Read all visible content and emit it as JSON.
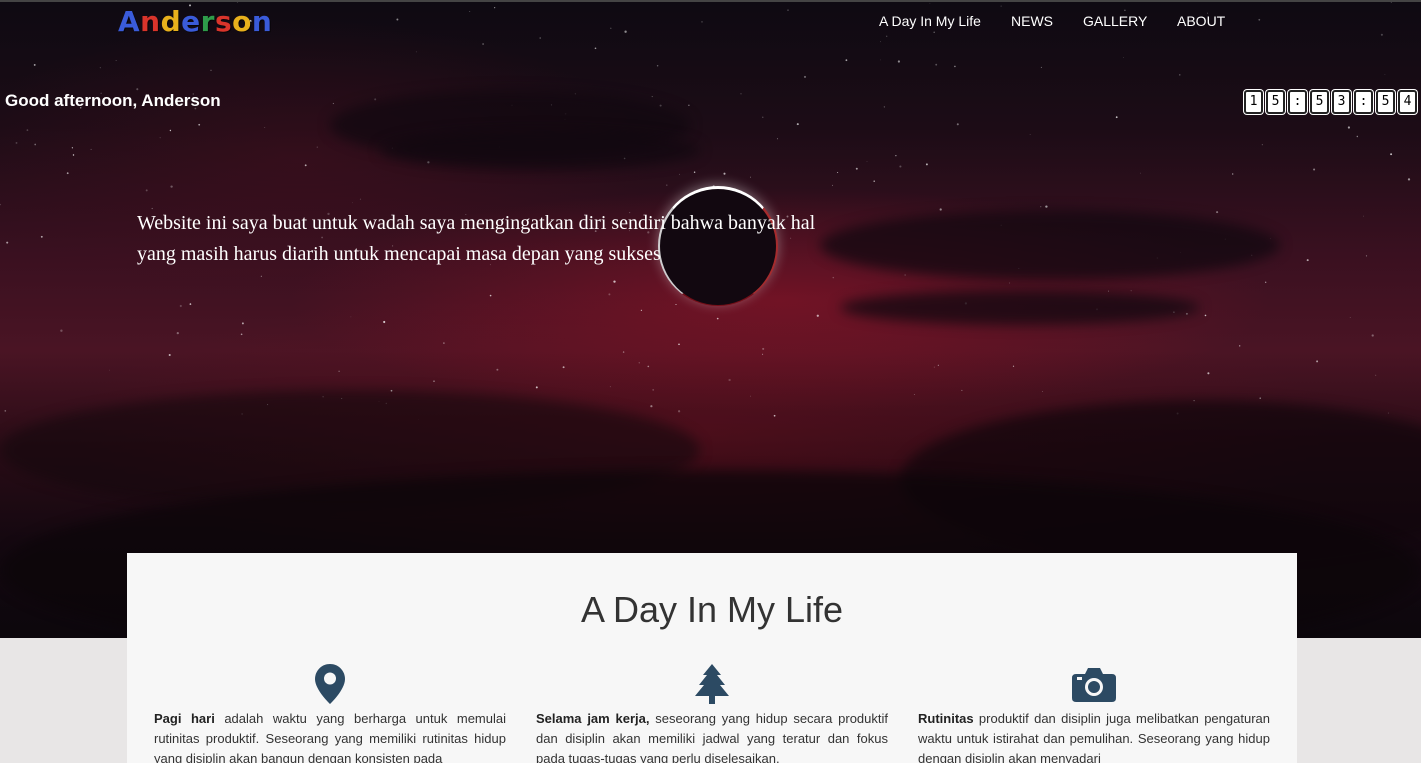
{
  "brand": {
    "logo_letters": [
      {
        "char": "A",
        "color": "#3a5bd9"
      },
      {
        "char": "n",
        "color": "#d9342b"
      },
      {
        "char": "d",
        "color": "#e8b01c"
      },
      {
        "char": "e",
        "color": "#3a5bd9"
      },
      {
        "char": "r",
        "color": "#2e9c4a"
      },
      {
        "char": "s",
        "color": "#d9342b"
      },
      {
        "char": "o",
        "color": "#e8b01c"
      },
      {
        "char": "n",
        "color": "#3a5bd9"
      }
    ]
  },
  "nav": {
    "items": [
      "A Day In My Life",
      "NEWS",
      "GALLERY",
      "ABOUT"
    ]
  },
  "hero": {
    "greeting": "Good afternoon, Anderson",
    "clock": [
      "1",
      "5",
      ":",
      "5",
      "3",
      ":",
      "5",
      "4"
    ],
    "tagline": "Website ini saya buat untuk wadah saya mengingatkan diri sendiri bahwa banyak hal yang masih harus diarih untuk mencapai masa depan yang sukses"
  },
  "section": {
    "title": "A Day In My Life",
    "columns": [
      {
        "icon": "map-pin-icon",
        "bold": "Pagi hari",
        "text": " adalah waktu yang berharga untuk memulai rutinitas produktif. Seseorang yang memiliki rutinitas hidup yang disiplin akan bangun dengan konsisten pada"
      },
      {
        "icon": "tree-icon",
        "bold": "Selama jam kerja,",
        "text": " seseorang yang hidup secara produktif dan disiplin akan memiliki jadwal yang teratur dan fokus pada tugas-tugas yang perlu diselesaikan."
      },
      {
        "icon": "camera-icon",
        "bold": "Rutinitas",
        "text": " produktif dan disiplin juga melibatkan pengaturan waktu untuk istirahat dan pemulihan. Seseorang yang hidup dengan disiplin akan menyadari"
      }
    ]
  },
  "colors": {
    "icon": "#2c4a63",
    "panel": "#f7f7f7",
    "page_bg": "#e8e6e6"
  }
}
